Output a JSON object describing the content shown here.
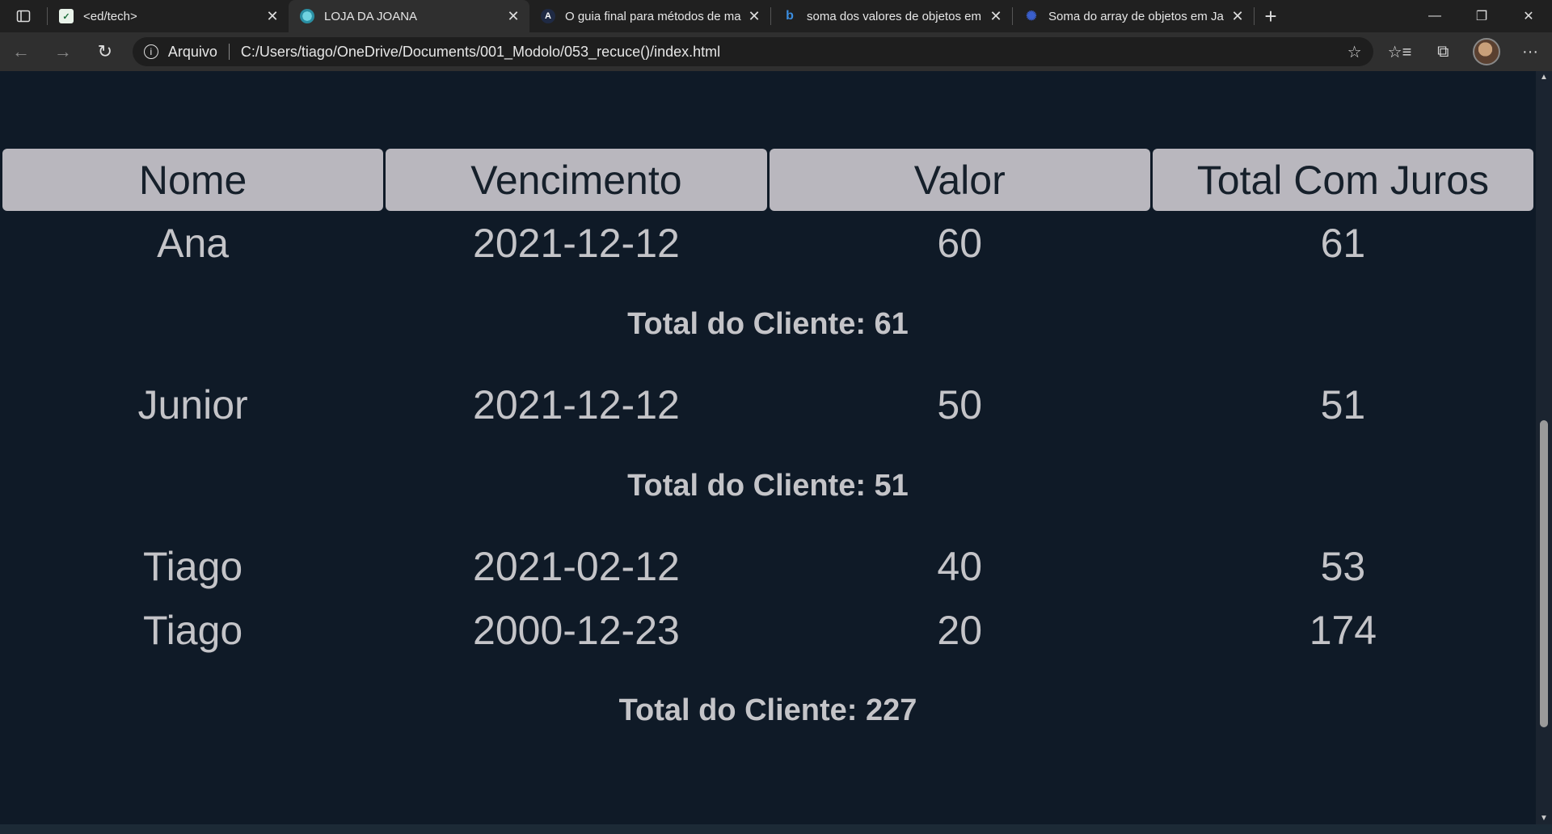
{
  "browser": {
    "tabs": [
      {
        "title": "<ed/tech>",
        "icon": "edtech-icon",
        "active": false
      },
      {
        "title": "LOJA DA JOANA",
        "icon": "page-globe-icon",
        "active": true
      },
      {
        "title": "O guia final para métodos de ma",
        "icon": "a-logo-icon",
        "active": false
      },
      {
        "title": "soma dos valores de objetos em",
        "icon": "bing-icon",
        "active": false
      },
      {
        "title": "Soma do array de objetos em Ja",
        "icon": "gear-site-icon",
        "active": false
      }
    ],
    "address": {
      "scheme_label": "Arquivo",
      "url": "C:/Users/tiago/OneDrive/Documents/001_Modolo/053_recuce()/index.html"
    }
  },
  "table": {
    "headers": [
      "Nome",
      "Vencimento",
      "Valor",
      "Total Com Juros"
    ],
    "groups": [
      {
        "rows": [
          {
            "nome": "Ana",
            "vencimento": "2021-12-12",
            "valor": "60",
            "total": "61"
          }
        ],
        "total_label": "Total do Cliente: 61"
      },
      {
        "rows": [
          {
            "nome": "Junior",
            "vencimento": "2021-12-12",
            "valor": "50",
            "total": "51"
          }
        ],
        "total_label": "Total do Cliente: 51"
      },
      {
        "rows": [
          {
            "nome": "Tiago",
            "vencimento": "2021-02-12",
            "valor": "40",
            "total": "53"
          },
          {
            "nome": "Tiago",
            "vencimento": "2000-12-23",
            "valor": "20",
            "total": "174"
          }
        ],
        "total_label": "Total do Cliente: 227"
      }
    ]
  }
}
